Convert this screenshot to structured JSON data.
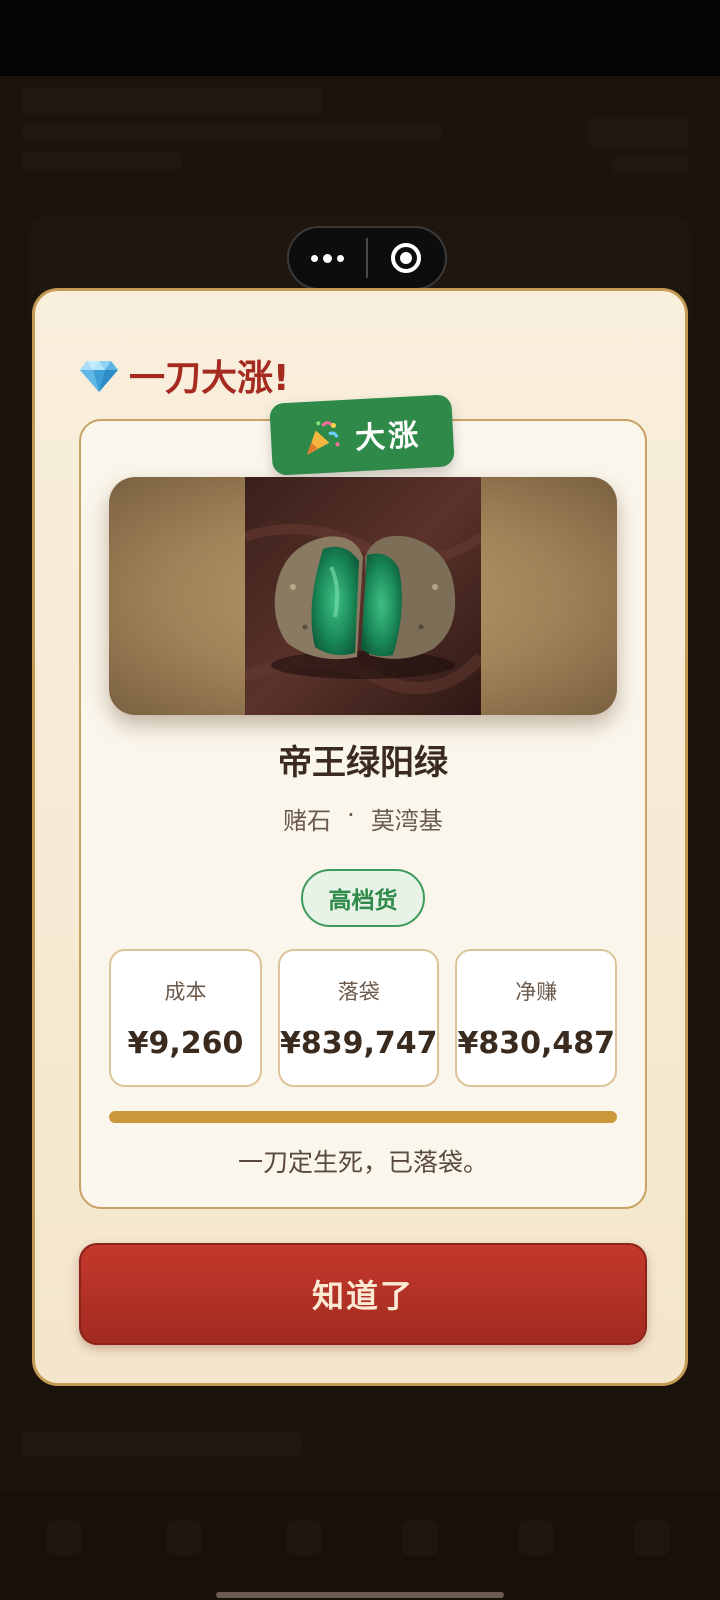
{
  "modal": {
    "title": "一刀大涨!",
    "title_icon": "gem-icon",
    "badge": {
      "label": "大涨",
      "icon": "party-popper-icon"
    },
    "stone": {
      "name": "帝王绿阳绿",
      "category": "赌石",
      "separator": "·",
      "origin": "莫湾基",
      "grade": "高档货"
    },
    "stats": [
      {
        "label": "成本",
        "value": "¥9,260"
      },
      {
        "label": "落袋",
        "value": "¥839,747"
      },
      {
        "label": "净赚",
        "value": "¥830,487"
      }
    ],
    "progress": 1.0,
    "note": "一刀定生死，已落袋。",
    "confirm_label": "知道了"
  },
  "colors": {
    "title": "#a52a1f",
    "badge": "#2f8a4a",
    "button": "#b3322a",
    "progress": "#c9983a",
    "card_border": "#c9a165"
  }
}
